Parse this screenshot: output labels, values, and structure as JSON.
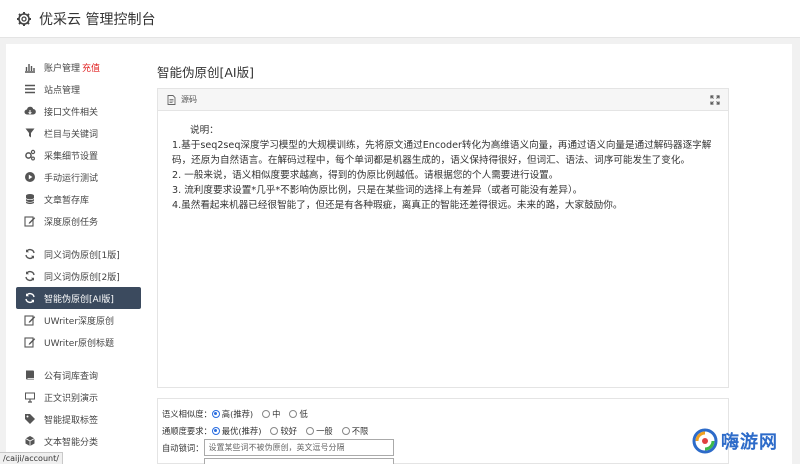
{
  "app": {
    "title": "优采云 管理控制台"
  },
  "sidebar": {
    "items": [
      {
        "label": "账户管理",
        "badge": "充值",
        "icon": "bar-chart-icon"
      },
      {
        "label": "站点管理",
        "icon": "list-icon"
      },
      {
        "label": "接口文件相关",
        "icon": "cloud-download-icon"
      },
      {
        "label": "栏目与关键词",
        "icon": "filter-icon"
      },
      {
        "label": "采集细节设置",
        "icon": "gears-icon"
      },
      {
        "label": "手动运行测试",
        "icon": "play-icon"
      },
      {
        "label": "文章暂存库",
        "icon": "database-icon"
      },
      {
        "label": "深度原创任务",
        "icon": "edit-icon"
      },
      {
        "label": "同义词伪原创[1版]",
        "icon": "refresh-icon"
      },
      {
        "label": "同义词伪原创[2版]",
        "icon": "refresh-icon"
      },
      {
        "label": "智能伪原创[AI版]",
        "icon": "refresh-icon",
        "active": true
      },
      {
        "label": "UWriter深度原创",
        "icon": "edit-icon"
      },
      {
        "label": "UWriter原创标题",
        "icon": "edit-icon"
      },
      {
        "label": "公有词库查询",
        "icon": "book-icon"
      },
      {
        "label": "正文识别演示",
        "icon": "monitor-icon"
      },
      {
        "label": "智能提取标签",
        "icon": "tag-icon"
      },
      {
        "label": "文本智能分类",
        "icon": "cube-icon"
      }
    ]
  },
  "main": {
    "title": "智能伪原创[AI版]",
    "card": {
      "header": "源码",
      "lines": [
        "说明：",
        "1.基于seq2seq深度学习模型的大规模训练，先将原文通过Encoder转化为高维语义向量，再通过语义向量是通过解码器逐字解码，还原为自然语言。在解码过程中，每个单词都是机器生成的，语义保持得很好，但词汇、语法、词序可能发生了变化。",
        "2. 一般来说，语义相似度要求越高，得到的伪原比例越低。请根据您的个人需要进行设置。",
        "3. 流利度要求设置*几乎*不影响伪原比例，只是在某些词的选择上有差异（或者可能没有差异）。",
        "4.虽然看起来机器已经很智能了，但还是有各种瑕疵，离真正的智能还差得很远。未来的路，大家鼓励你。"
      ]
    },
    "options": {
      "similarity": {
        "label": "语义相似度：",
        "choices": [
          {
            "label": "高(推荐)",
            "checked": true
          },
          {
            "label": "中",
            "checked": false
          },
          {
            "label": "低",
            "checked": false
          }
        ]
      },
      "fluency": {
        "label": "通顺度要求：",
        "choices": [
          {
            "label": "最优(推荐)",
            "checked": true
          },
          {
            "label": "较好",
            "checked": false
          },
          {
            "label": "一般",
            "checked": false
          },
          {
            "label": "不限",
            "checked": false
          }
        ]
      },
      "lock_words": {
        "label": "自动锁词：",
        "placeholder": "设置某些词不被伪原创，英文逗号分隔"
      }
    }
  },
  "status_url": "/caiji/account/",
  "watermark": {
    "text": "嗨游网"
  },
  "colors": {
    "active_bg": "#3b4a5e",
    "badge": "#e02020",
    "radio_checked": "#2a6de0"
  }
}
